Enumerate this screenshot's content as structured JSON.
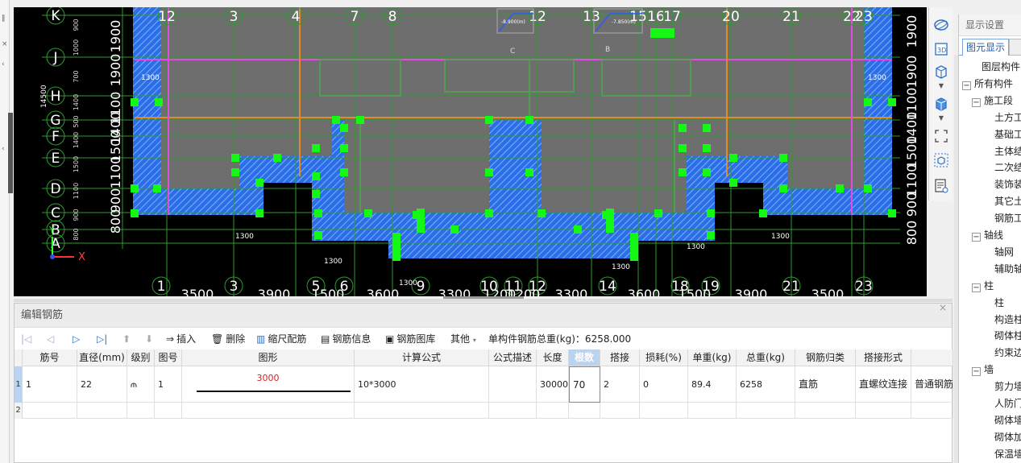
{
  "left_strip": {
    "marks": [
      "‖",
      "×",
      "‹",
      "‹"
    ]
  },
  "cad": {
    "axis_top": [
      "12",
      "3",
      "4",
      "7",
      "8",
      "12",
      "13",
      "15",
      "16",
      "17",
      "20",
      "21",
      "22",
      "23"
    ],
    "axis_bottom": [
      "1",
      "3",
      "5",
      "6",
      "9",
      "10",
      "11",
      "12",
      "14",
      "18",
      "19",
      "21",
      "23"
    ],
    "dims_bottom": [
      "3500",
      "3900",
      "1500",
      "3600",
      "3300",
      "1200",
      "1200",
      "3300",
      "3600",
      "1500",
      "3900",
      "3500"
    ],
    "axis_left": [
      "K",
      "J",
      "H",
      "G",
      "F",
      "E",
      "D",
      "C",
      "B",
      "A"
    ],
    "axis_right": [
      "C",
      "B",
      "A"
    ],
    "dims_left": [
      "1900",
      "1900",
      "1100",
      "1400",
      "1500",
      "1100",
      "900",
      "800"
    ],
    "dims_right": [
      "1900",
      "1900",
      "1100",
      "1400",
      "1500",
      "1100",
      "900",
      "800"
    ],
    "small_dims_left": [
      "900",
      "1000",
      "700",
      "1400",
      "500",
      "1400",
      "1500",
      "1100",
      "900",
      "800"
    ],
    "total_dim_left": "14500",
    "dim_1300": "1300",
    "labels_slab": [
      "C",
      "B"
    ],
    "elev_label_1": "-8.900(m)",
    "elev_label_2": "-7.850(m)",
    "coord_x": "X",
    "coord_y": "Y"
  },
  "view_toolbar": {
    "icons": [
      "orbit-icon",
      "view-3d-icon",
      "box-icon",
      "dropdown-icon",
      "cube-icon",
      "dropdown-icon",
      "select-frame-icon",
      "component-icon",
      "properties-icon"
    ],
    "label_3d": "3D"
  },
  "display_panel": {
    "title": "显示设置",
    "tab_active": "图元显示",
    "tree": [
      {
        "label": "图层构件",
        "level": 0,
        "box": ""
      },
      {
        "label": "所有构件",
        "level": 0,
        "box": "−"
      },
      {
        "label": "施工段",
        "level": 1,
        "box": "−"
      },
      {
        "label": "土方工",
        "level": 2,
        "box": ""
      },
      {
        "label": "基础工",
        "level": 2,
        "box": ""
      },
      {
        "label": "主体结",
        "level": 2,
        "box": ""
      },
      {
        "label": "二次结",
        "level": 2,
        "box": ""
      },
      {
        "label": "装饰装",
        "level": 2,
        "box": ""
      },
      {
        "label": "其它土",
        "level": 2,
        "box": ""
      },
      {
        "label": "钢筋工",
        "level": 2,
        "box": ""
      },
      {
        "label": "轴线",
        "level": 1,
        "box": "−"
      },
      {
        "label": "轴网",
        "level": 2,
        "box": ""
      },
      {
        "label": "辅助轴",
        "level": 2,
        "box": ""
      },
      {
        "label": "柱",
        "level": 1,
        "box": "−"
      },
      {
        "label": "柱",
        "level": 2,
        "box": ""
      },
      {
        "label": "构造柱",
        "level": 2,
        "box": ""
      },
      {
        "label": "砌体柱",
        "level": 2,
        "box": ""
      },
      {
        "label": "约束边",
        "level": 2,
        "box": ""
      },
      {
        "label": "墙",
        "level": 1,
        "box": "−"
      },
      {
        "label": "剪力墙",
        "level": 2,
        "box": ""
      },
      {
        "label": "人防门",
        "level": 2,
        "box": ""
      },
      {
        "label": "砌体墙",
        "level": 2,
        "box": ""
      },
      {
        "label": "砌体加",
        "level": 2,
        "box": ""
      },
      {
        "label": "保温墙",
        "level": 2,
        "box": ""
      }
    ]
  },
  "edit_panel": {
    "title": "编辑钢筋",
    "toolbar": {
      "insert": "插入",
      "delete": "删除",
      "scale_rebar": "缩尺配筋",
      "rebar_info": "钢筋信息",
      "rebar_library": "钢筋图库",
      "other": "其他",
      "total_weight": "单构件钢筋总重(kg)：6258.000"
    },
    "columns": [
      "筋号",
      "直径(mm)",
      "级别",
      "图号",
      "图形",
      "计算公式",
      "公式描述",
      "长度",
      "根数",
      "搭接",
      "损耗(%)",
      "单重(kg)",
      "总重(kg)",
      "钢筋归类",
      "搭接形式",
      ""
    ],
    "rows": [
      {
        "num": "1",
        "cells": [
          "1",
          "22",
          "⫙",
          "1",
          "3000",
          "10*3000",
          "",
          "30000",
          "70",
          "2",
          "0",
          "89.4",
          "6258",
          "直筋",
          "直螺纹连接",
          "普通钢筋"
        ]
      },
      {
        "num": "2",
        "cells": []
      }
    ]
  }
}
